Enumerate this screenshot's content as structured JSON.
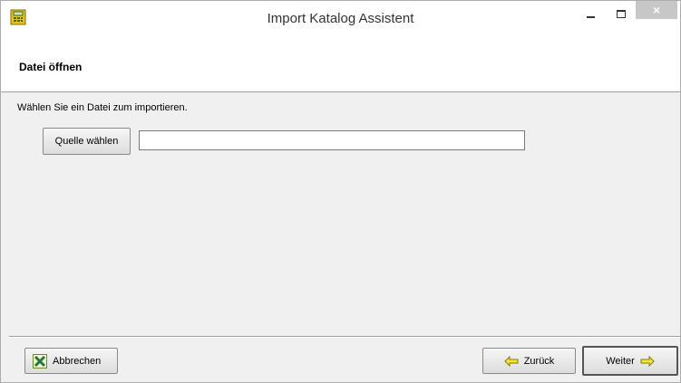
{
  "window": {
    "title": "Import Katalog Assistent",
    "icon": "calculator-app-icon"
  },
  "controls": {
    "minimize": "minimize-icon",
    "maximize": "maximize-icon",
    "close_glyph": "×"
  },
  "header": {
    "step_title": "Datei öffnen"
  },
  "main": {
    "instruction": "Wählen Sie ein Datei zum importieren.",
    "source_button_label": "Quelle wählen",
    "path_value": "",
    "path_placeholder": ""
  },
  "footer": {
    "cancel_label": "Abbrechen",
    "back_label": "Zurück",
    "next_label": "Weiter"
  },
  "colors": {
    "window_bg": "#f0f0f0",
    "header_bg": "#ffffff",
    "arrow_yellow": "#f5e43a",
    "excel_green": "#1d7a3a"
  }
}
